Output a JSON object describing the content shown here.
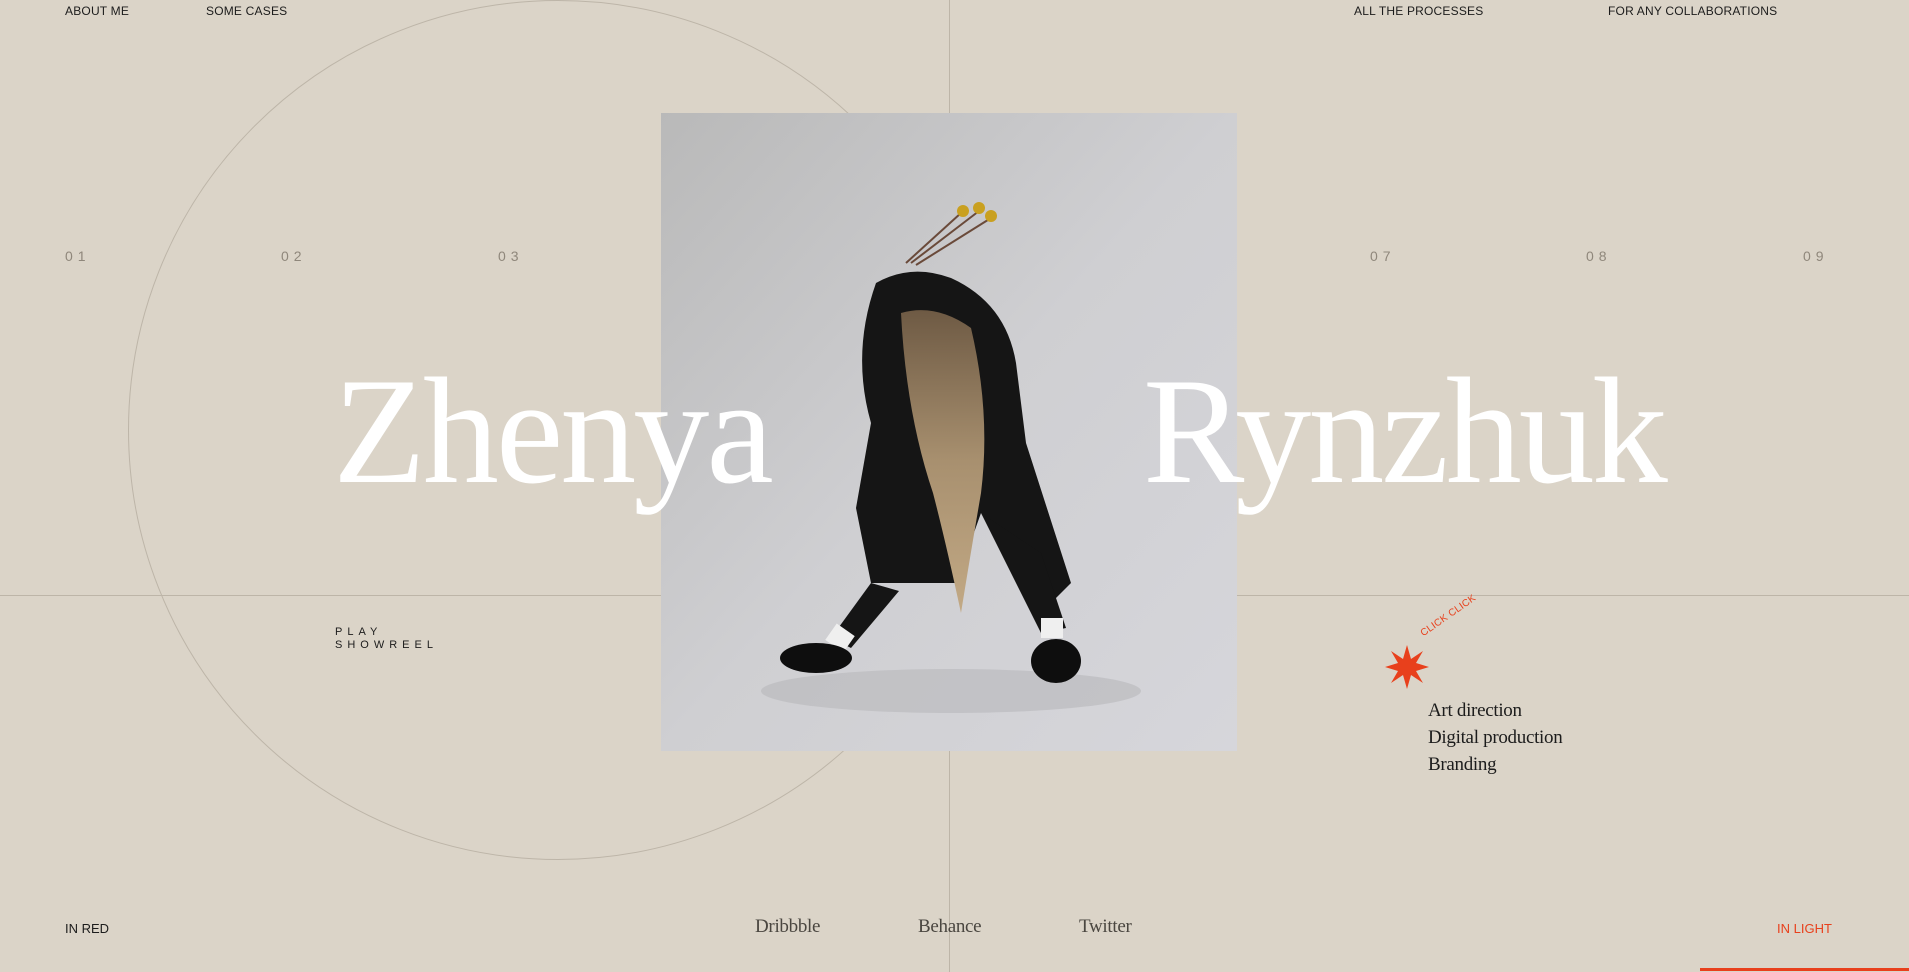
{
  "nav": {
    "about": "ABOUT ME",
    "cases": "SOME CASES",
    "processes": "ALL THE PROCESSES",
    "collaborations": "FOR ANY COLLABORATIONS"
  },
  "numbers": [
    "01",
    "02",
    "03",
    "07",
    "08",
    "09"
  ],
  "hero": {
    "first_name": "Zhenya",
    "last_name": "Rynzhuk"
  },
  "showreel": {
    "line1": "PLAY",
    "line2": "SHOWREEL"
  },
  "badge": {
    "text": "CLICK CLICK",
    "icon": "starburst-icon"
  },
  "services": [
    "Art direction",
    "Digital production",
    "Branding"
  ],
  "footer": {
    "left": "IN RED",
    "right": "IN LIGHT",
    "social": [
      "Dribbble",
      "Behance",
      "Twitter"
    ]
  },
  "colors": {
    "background": "#dbd4c8",
    "accent": "#e8401c",
    "text": "#1c1c1c",
    "hero_text": "#ffffff"
  }
}
